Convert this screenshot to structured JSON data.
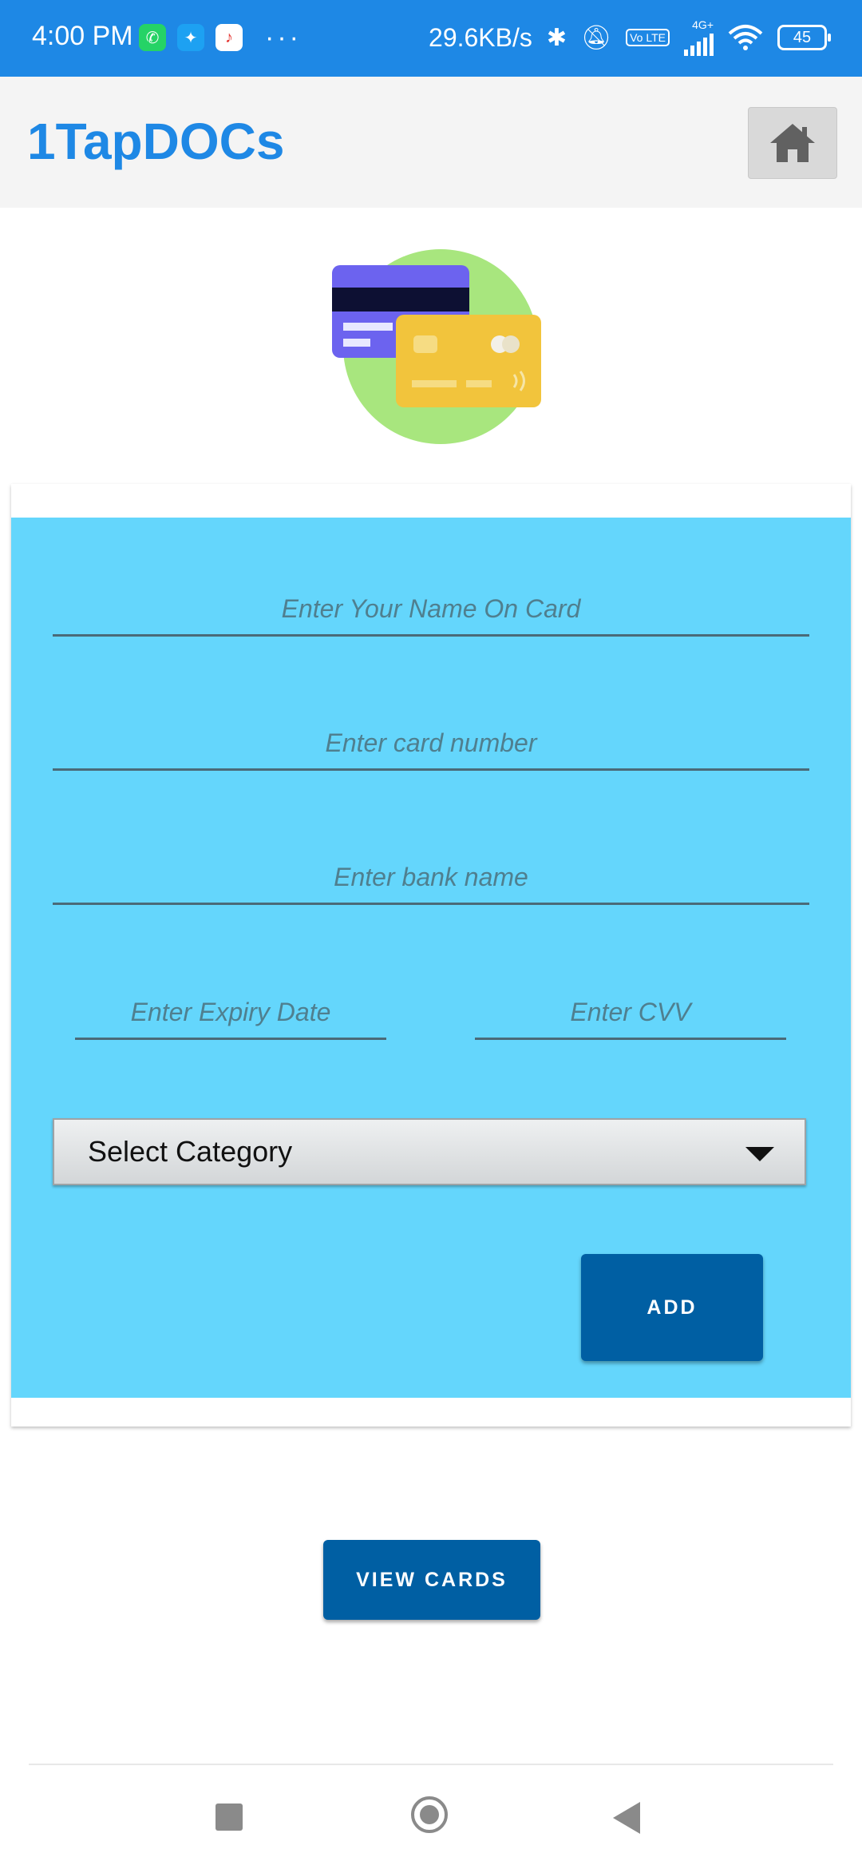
{
  "status_bar": {
    "time": "4:00 PM",
    "more": "···",
    "network_speed": "29.6KB/s",
    "volte": "Vo LTE",
    "network_type": "4G+",
    "battery": "45"
  },
  "header": {
    "title": "1TapDOCs",
    "home_icon": "home-icon"
  },
  "form": {
    "name_placeholder": "Enter Your Name On Card",
    "card_number_placeholder": "Enter card number",
    "bank_name_placeholder": "Enter bank name",
    "expiry_placeholder": "Enter Expiry Date",
    "cvv_placeholder": "Enter CVV",
    "category_selected": "Select Category",
    "add_label": "ADD"
  },
  "view_cards_label": "VIEW CARDS",
  "colors": {
    "status_bar": "#1e88e5",
    "title": "#1e88e5",
    "form_background": "#64d6fc",
    "button": "#005fa3"
  }
}
